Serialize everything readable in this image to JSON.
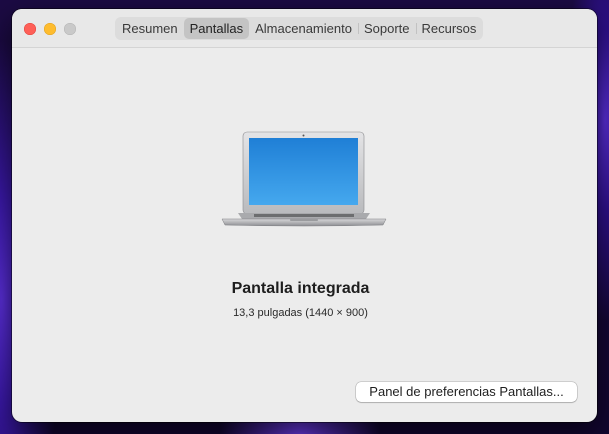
{
  "window": {
    "tabs": [
      {
        "label": "Resumen",
        "active": false
      },
      {
        "label": "Pantallas",
        "active": true
      },
      {
        "label": "Almacenamiento",
        "active": false
      },
      {
        "label": "Soporte",
        "active": false
      },
      {
        "label": "Recursos",
        "active": false
      }
    ]
  },
  "display": {
    "name": "Pantalla integrada",
    "size": "13,3 pulgadas (1440 × 900)",
    "device_icon": "laptop-icon"
  },
  "preferences_button": {
    "label": "Panel de preferencias Pantallas..."
  },
  "colors": {
    "close": "#fe5f57",
    "minimize": "#febc2e",
    "zoom": "#c9c9c9",
    "screen_blue": "#2f8fe0",
    "window_bg": "#ececec"
  }
}
